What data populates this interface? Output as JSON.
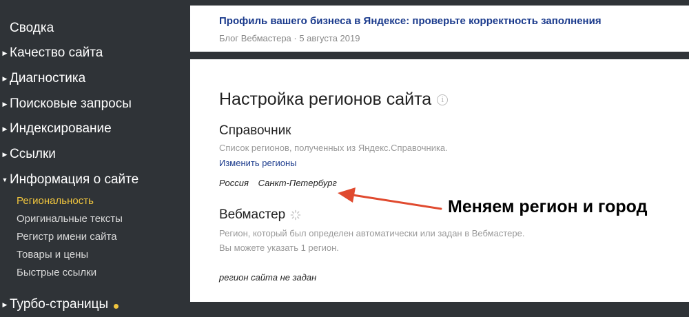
{
  "sidebar": {
    "items": [
      {
        "label": "Сводка",
        "has_arrow": false
      },
      {
        "label": "Качество сайта",
        "has_arrow": true
      },
      {
        "label": "Диагностика",
        "has_arrow": true
      },
      {
        "label": "Поисковые запросы",
        "has_arrow": true
      },
      {
        "label": "Индексирование",
        "has_arrow": true
      },
      {
        "label": "Ссылки",
        "has_arrow": true
      },
      {
        "label": "Информация о сайте",
        "has_arrow": true,
        "expanded": true
      },
      {
        "label": "Турбо-страницы",
        "has_arrow": true,
        "badge_color": "#f0c53e"
      }
    ],
    "subitems": [
      {
        "label": "Региональность",
        "active": true
      },
      {
        "label": "Оригинальные тексты"
      },
      {
        "label": "Регистр имени сайта"
      },
      {
        "label": "Товары и цены"
      },
      {
        "label": "Быстрые ссылки"
      }
    ]
  },
  "news": {
    "title": "Профиль вашего бизнеса в Яндексе: проверьте корректность заполнения",
    "meta": "Блог Вебмастера · 5 августа 2019"
  },
  "main": {
    "title": "Настройка регионов сайта",
    "directory": {
      "title": "Справочник",
      "description": "Список регионов, полученных из Яндекс.Справочника.",
      "change_link": "Изменить регионы",
      "country": "Россия",
      "city": "Санкт-Петербург"
    },
    "webmaster": {
      "title": "Вебмастер",
      "description_line1": "Регион, который был определен автоматически или задан в Вебмастере.",
      "description_line2": "Вы можете указать 1 регион.",
      "status": "регион сайта не задан"
    }
  },
  "annotation": {
    "text": "Меняем регион и город",
    "arrow_color": "#e04a2f"
  },
  "colors": {
    "sidebar_bg": "#2f3337",
    "active": "#f0c53e",
    "link": "#1a3a8c"
  }
}
